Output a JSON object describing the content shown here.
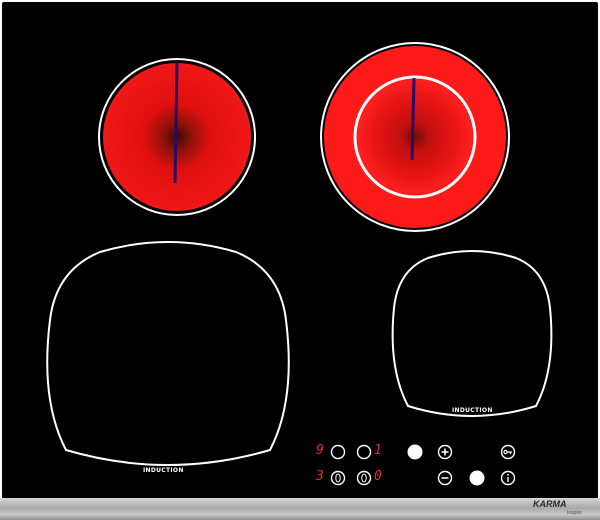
{
  "cooktop": {
    "zones": [
      {
        "type": "radiant",
        "state": "on",
        "color": "#e01010"
      },
      {
        "type": "radiant-dual",
        "state": "on",
        "color": "#e01010"
      },
      {
        "type": "induction",
        "label": "INDUCTION",
        "state": "off"
      },
      {
        "type": "induction",
        "label": "INDUCTION",
        "state": "off"
      }
    ],
    "controls": {
      "row1_left_digit": "9",
      "row1_mid_digit": "1",
      "row2_left_digit": "3",
      "row2_mid_digit": "0",
      "plus": "+",
      "minus": "−",
      "display_color": "#e0302a"
    },
    "brand": {
      "name": "KARMA",
      "sub": "Inspire"
    }
  }
}
